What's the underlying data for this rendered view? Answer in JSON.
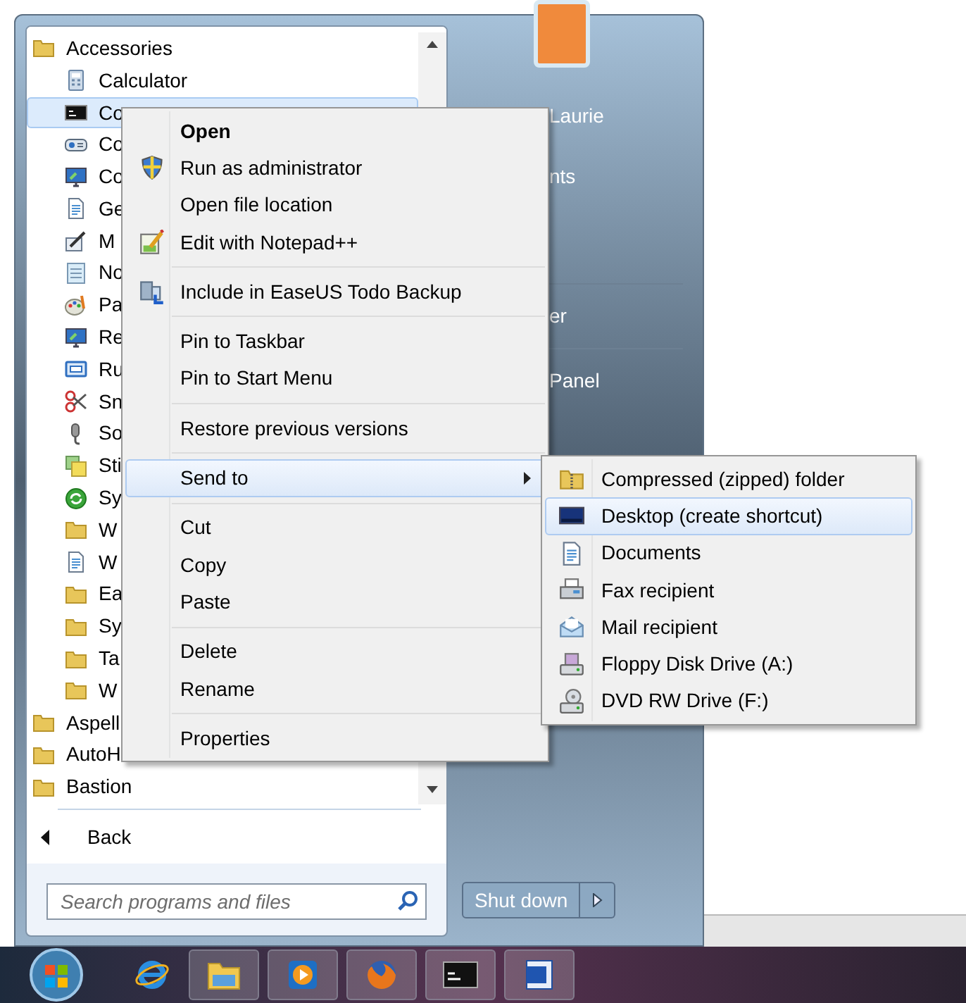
{
  "start_menu": {
    "programs": [
      {
        "label": "Accessories",
        "selected": false,
        "children": [
          {
            "label": "Calculator",
            "selected": false
          },
          {
            "label": "Co",
            "selected": true
          },
          {
            "label": "Co",
            "selected": false
          },
          {
            "label": "Co",
            "selected": false
          },
          {
            "label": "Ge",
            "selected": false
          },
          {
            "label": "M",
            "selected": false
          },
          {
            "label": "No",
            "selected": false
          },
          {
            "label": "Pa",
            "selected": false
          },
          {
            "label": "Re",
            "selected": false
          },
          {
            "label": "Ru",
            "selected": false
          },
          {
            "label": "Sn",
            "selected": false
          },
          {
            "label": "So",
            "selected": false
          },
          {
            "label": "Sti",
            "selected": false
          },
          {
            "label": "Sy",
            "selected": false
          },
          {
            "label": "W",
            "selected": false
          },
          {
            "label": "W",
            "selected": false
          },
          {
            "label": "Ea",
            "selected": false
          },
          {
            "label": "Sy",
            "selected": false
          },
          {
            "label": "Ta",
            "selected": false
          },
          {
            "label": "W",
            "selected": false
          }
        ]
      },
      {
        "label": "Aspell",
        "selected": false
      },
      {
        "label": "AutoH",
        "selected": false
      },
      {
        "label": "Bastion",
        "selected": false
      }
    ],
    "back": "Back",
    "search": {
      "placeholder": "Search programs and files"
    },
    "user_links": [
      [
        "Laurie",
        "nts"
      ],
      [
        "er"
      ],
      [
        "Panel"
      ]
    ],
    "shut_down": "Shut down"
  },
  "context_menu": {
    "groups": [
      [
        {
          "label": "Open",
          "default": true,
          "selected": false,
          "submenu": false
        },
        {
          "label": "Run as administrator",
          "default": false,
          "selected": false,
          "submenu": false
        },
        {
          "label": "Open file location",
          "default": false,
          "selected": false,
          "submenu": false
        },
        {
          "label": "Edit with Notepad++",
          "default": false,
          "selected": false,
          "submenu": false
        }
      ],
      [
        {
          "label": "Include in EaseUS Todo Backup",
          "default": false,
          "selected": false,
          "submenu": false
        }
      ],
      [
        {
          "label": "Pin to Taskbar",
          "default": false,
          "selected": false,
          "submenu": false
        },
        {
          "label": "Pin to Start Menu",
          "default": false,
          "selected": false,
          "submenu": false
        }
      ],
      [
        {
          "label": "Restore previous versions",
          "default": false,
          "selected": false,
          "submenu": false
        }
      ],
      [
        {
          "label": "Send to",
          "default": false,
          "selected": true,
          "submenu": true
        }
      ],
      [
        {
          "label": "Cut",
          "default": false,
          "selected": false,
          "submenu": false
        },
        {
          "label": "Copy",
          "default": false,
          "selected": false,
          "submenu": false
        },
        {
          "label": "Paste",
          "default": false,
          "selected": false,
          "submenu": false
        }
      ],
      [
        {
          "label": "Delete",
          "default": false,
          "selected": false,
          "submenu": false
        },
        {
          "label": "Rename",
          "default": false,
          "selected": false,
          "submenu": false
        }
      ],
      [
        {
          "label": "Properties",
          "default": false,
          "selected": false,
          "submenu": false
        }
      ]
    ]
  },
  "send_to_menu": {
    "items": [
      {
        "label": "Compressed (zipped) folder",
        "selected": false
      },
      {
        "label": "Desktop (create shortcut)",
        "selected": true
      },
      {
        "label": "Documents",
        "selected": false
      },
      {
        "label": "Fax recipient",
        "selected": false
      },
      {
        "label": "Mail recipient",
        "selected": false
      },
      {
        "label": "Floppy Disk Drive (A:)",
        "selected": false
      },
      {
        "label": "DVD RW Drive (F:)",
        "selected": false
      }
    ]
  }
}
